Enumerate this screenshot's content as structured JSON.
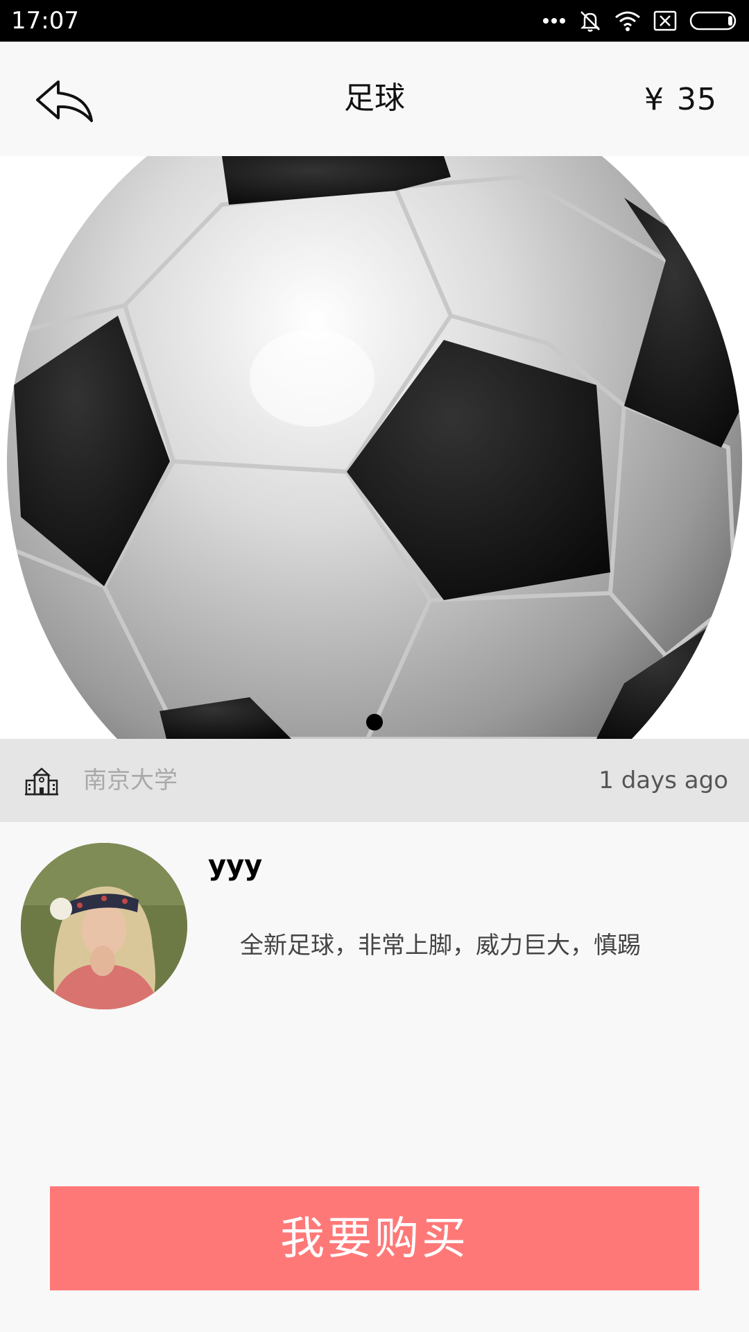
{
  "status_bar": {
    "time": "17:07",
    "icons": [
      "more-dots-icon",
      "silent-bell-icon",
      "wifi-icon",
      "sim-blocked-icon",
      "battery-icon"
    ]
  },
  "header": {
    "back_icon": "back-arrow-icon",
    "title": "足球",
    "currency": "¥",
    "price": "35"
  },
  "carousel": {
    "image": "soccer-ball-photo",
    "page_count": 1,
    "current_page": 1
  },
  "location": {
    "icon": "school-building-icon",
    "campus": "南京大学",
    "posted": "1 days ago"
  },
  "seller": {
    "avatar": "user-avatar-photo",
    "name": "yyy",
    "description": "全新足球，非常上脚，威力巨大，慎踢"
  },
  "actions": {
    "buy_label": "我要购买"
  },
  "colors": {
    "status_bar": "#000000",
    "background": "#f8f8f8",
    "location_bar": "#e5e5e5",
    "buy_button": "#ff7878"
  }
}
